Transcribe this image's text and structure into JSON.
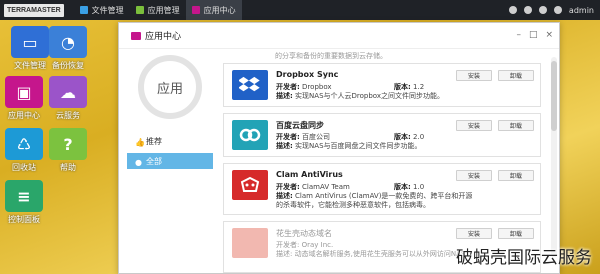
{
  "topbar": {
    "logo": "TERRAMASTER",
    "tasks": [
      {
        "label": "文件管理",
        "color": "#3aa0e6"
      },
      {
        "label": "应用管理",
        "color": "#7bbf3c"
      },
      {
        "label": "应用中心",
        "color": "#c5168c"
      }
    ],
    "user": "admin"
  },
  "desktop": [
    {
      "label": "文件管理",
      "color": "#2f6fd6",
      "glyph": "▭"
    },
    {
      "label": "备份恢复",
      "color": "#3b80d8",
      "glyph": "◔"
    },
    {
      "label": "应用中心",
      "color": "#c5168c",
      "glyph": "▣"
    },
    {
      "label": "云服务",
      "color": "#9b54c9",
      "glyph": "☁"
    },
    {
      "label": "回收站",
      "color": "#1d9ad6",
      "glyph": "♺"
    },
    {
      "label": "帮助",
      "color": "#7cc23f",
      "glyph": "?"
    },
    {
      "label": "控制面板",
      "color": "#2aa66a",
      "glyph": "≡"
    }
  ],
  "window": {
    "title": "应用中心",
    "controls": [
      "–",
      "□",
      "×"
    ],
    "circle_label": "应用",
    "nav": [
      {
        "label": "推荐",
        "selected": false
      },
      {
        "label": "全部",
        "selected": true
      }
    ],
    "top_partial": "的分享和备份的重要数据到云存储。",
    "apps": [
      {
        "name": "Dropbox Sync",
        "dev_label": "开发者:",
        "dev": "Dropbox",
        "ver_label": "版本:",
        "ver": "1.2",
        "desc_label": "描述:",
        "desc": "实现NAS与个人云Dropbox之间文件同步功能。",
        "icon_color": "#2061c7",
        "icon": "dropbox-icon",
        "install": "安装",
        "remove": "卸载"
      },
      {
        "name": "百度云盘同步",
        "dev_label": "开发者:",
        "dev": "百度公司",
        "ver_label": "版本:",
        "ver": "2.0",
        "desc_label": "描述:",
        "desc": "实现NAS与百度网盘之间文件同步功能。",
        "icon_color": "#22a3b6",
        "icon": "baidu-cloud-icon",
        "install": "安装",
        "remove": "卸载"
      },
      {
        "name": "Clam AntiVirus",
        "dev_label": "开发者:",
        "dev": "ClamAV Team",
        "ver_label": "版本:",
        "ver": "1.0",
        "desc_label": "描述:",
        "desc": "Clam AntiVirus (ClamAV)是一款免费的、跨平台和开源的杀毒软件，它能检测多种恶意软件，包括病毒。",
        "icon_color": "#d62a2a",
        "icon": "clamav-icon",
        "install": "安装",
        "remove": "卸载"
      },
      {
        "name": "花生壳动态域名",
        "dev_label": "开发者:",
        "dev": "Oray Inc.",
        "ver_label": "版本:",
        "ver": "",
        "desc_label": "描述:",
        "desc": "动态域名解析服务,使用花生壳服务可以从外网访问NAS",
        "icon_color": "#f2b8b0",
        "icon": "oray-icon",
        "install": "安装",
        "remove": "卸载"
      }
    ]
  },
  "watermark": "破蜗壳国际云服务"
}
